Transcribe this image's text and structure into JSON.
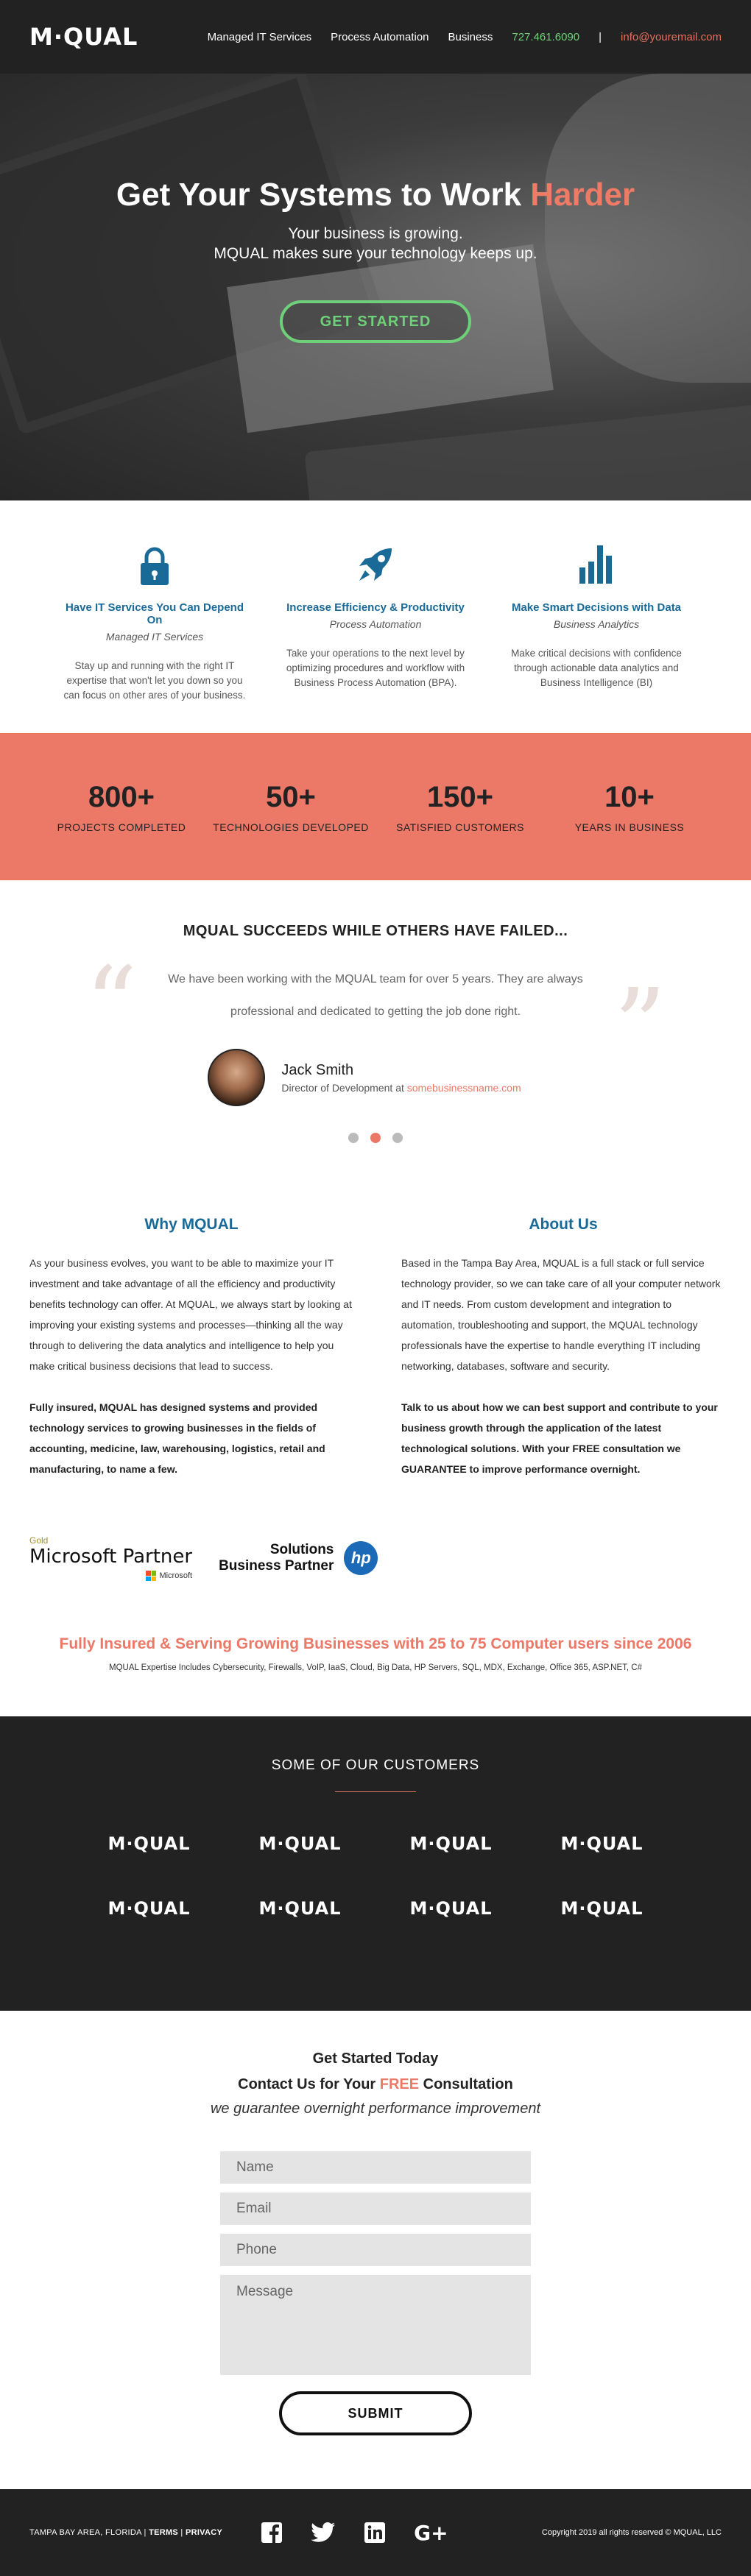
{
  "nav": {
    "logo": "M·QUAL",
    "links": [
      "Managed IT Services",
      "Process Automation",
      "Business"
    ],
    "phone": "727.461.6090",
    "separator": "|",
    "email": "info@youremail.com"
  },
  "hero": {
    "title_main": "Get Your Systems to Work ",
    "title_accent": "Harder",
    "subtitle_1": "Your business is growing.",
    "subtitle_2": "MQUAL makes sure your technology keeps up.",
    "cta": "GET STARTED"
  },
  "features": [
    {
      "icon": "lock-icon",
      "title": "Have IT Services You Can Depend On",
      "tag": "Managed IT Services",
      "text": "Stay up and running with the right IT expertise that won't let you down so you can focus on other ares of your business."
    },
    {
      "icon": "rocket-icon",
      "title": "Increase Efficiency & Productivity",
      "tag": "Process Automation",
      "text": "Take your operations to the next level by optimizing procedures and workflow with Business Process Automation (BPA)."
    },
    {
      "icon": "bar-chart-icon",
      "title": "Make Smart Decisions with Data",
      "tag": "Business Analytics",
      "text": "Make critical decisions with confidence through actionable data analytics and Business Intelligence (BI)"
    }
  ],
  "stats": [
    {
      "num": "800+",
      "label": "PROJECTS COMPLETED"
    },
    {
      "num": "50+",
      "label": "TECHNOLOGIES DEVELOPED"
    },
    {
      "num": "150+",
      "label": "SATISFIED CUSTOMERS"
    },
    {
      "num": "10+",
      "label": "YEARS IN BUSINESS"
    }
  ],
  "testimonial": {
    "heading": "MQUAL SUCCEEDS WHILE OTHERS HAVE FAILED...",
    "body": "We have been working with the MQUAL team for over 5 years. They are always professional and dedicated to getting the job done right.",
    "name": "Jack Smith",
    "role": "Director of Development at ",
    "company": "somebusinessname.com"
  },
  "why": {
    "title": "Why MQUAL",
    "p1": "As your business evolves, you want to be able to maximize your IT investment and take advantage of all the efficiency and productivity benefits technology can offer. At MQUAL, we always start by looking at improving your existing systems and processes—thinking all the way through to delivering the data analytics and intelligence to help you make critical business decisions that lead to success.",
    "p2": "Fully insured, MQUAL has designed systems and provided technology services to growing businesses in the fields of accounting, medicine, law, warehousing, logistics, retail and manufacturing, to name a few."
  },
  "about": {
    "title": "About Us",
    "p1": "Based in the Tampa Bay Area, MQUAL is a full stack or full service technology provider, so we can take care of all your computer network and IT needs. From custom development and integration to automation, troubleshooting and support, the MQUAL technology professionals have the expertise to handle everything IT including networking, databases, software and security.",
    "p2": "Talk to us about how we can best support and contribute to  your business growth through the application of the latest technological solutions. With your FREE consultation we GUARANTEE to improve performance overnight."
  },
  "partners": {
    "ms_gold": "Gold",
    "ms_partner": "Microsoft Partner",
    "ms_sub": "Microsoft",
    "hp_line1": "Solutions",
    "hp_line2": "Business Partner",
    "hp_logo": "hp"
  },
  "banner": {
    "title": "Fully Insured & Serving Growing Businesses with 25 to 75 Computer users since 2006",
    "text": "MQUAL Expertise Includes Cybersecurity, Firewalls, VoIP, IaaS, Cloud, Big Data, HP Servers, SQL, MDX, Exchange, Office 365, ASP.NET, C#"
  },
  "customers": {
    "title": "SOME OF OUR CUSTOMERS",
    "logos": [
      "M·QUAL",
      "M·QUAL",
      "M·QUAL",
      "M·QUAL",
      "M·QUAL",
      "M·QUAL",
      "M·QUAL",
      "M·QUAL"
    ]
  },
  "contact": {
    "title": "Get Started Today",
    "sub_pre": "Contact Us for Your ",
    "sub_free": "FREE",
    "sub_post": " Consultation",
    "guarantee": "we guarantee overnight performance improvement",
    "name_ph": "Name",
    "email_ph": "Email",
    "phone_ph": "Phone",
    "message_ph": "Message",
    "submit": "SUBMIT"
  },
  "footer": {
    "location": "TAMPA BAY AREA, FLORIDA | ",
    "terms": "TERMS",
    "sep": " | ",
    "privacy": "PRIVACY",
    "copyright": "Copyright 2019 all rights reserved © MQUAL, LLC",
    "social": [
      "facebook-icon",
      "twitter-icon",
      "linkedin-icon",
      "google-plus-icon"
    ],
    "gplus": "G+"
  },
  "colors": {
    "accent": "#ec7868",
    "green": "#6fd07a",
    "blue": "#1a6a98",
    "dark": "#222222"
  }
}
